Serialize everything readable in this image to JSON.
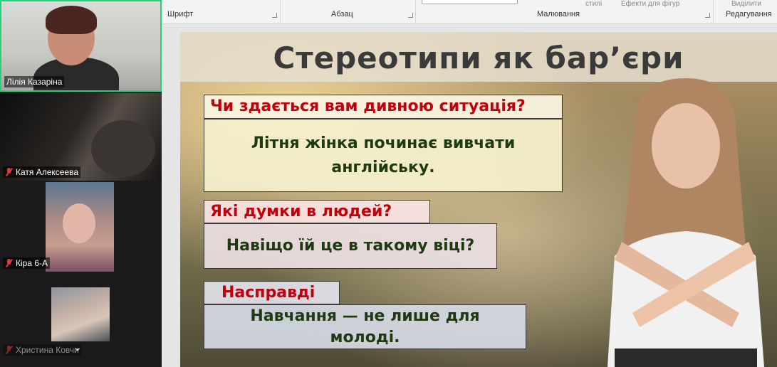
{
  "participants": [
    {
      "name": "Лілія Казаріна",
      "muted": false,
      "active_speaker": true
    },
    {
      "name": "Катя Алексеева",
      "muted": true
    },
    {
      "name": "Кіра 6-А",
      "muted": true
    },
    {
      "name": "Христина Ковчи",
      "muted": true
    }
  ],
  "ribbon": {
    "groups": [
      "Шрифт",
      "Абзац",
      "Малювання",
      "Редагування"
    ],
    "small_labels": [
      "стилі",
      "Ефекти для фігур",
      "Виділити"
    ]
  },
  "slide": {
    "title": "Стереотипи як бар’єри",
    "blocks": [
      {
        "question": "Чи здається вам дивною ситуація?",
        "answer": "Літня жінка починає вивчати англійську."
      },
      {
        "question": "Які думки в людей?",
        "answer": "Навіщо їй це в такому віці?"
      },
      {
        "question": "Насправді",
        "answer": "Навчання — не лише для молоді."
      }
    ]
  },
  "colors": {
    "active_speaker_border": "#26d07c",
    "question_text": "#c0000c",
    "answer_text": "#1f3a12",
    "muted_mic": "#e23b3b"
  }
}
